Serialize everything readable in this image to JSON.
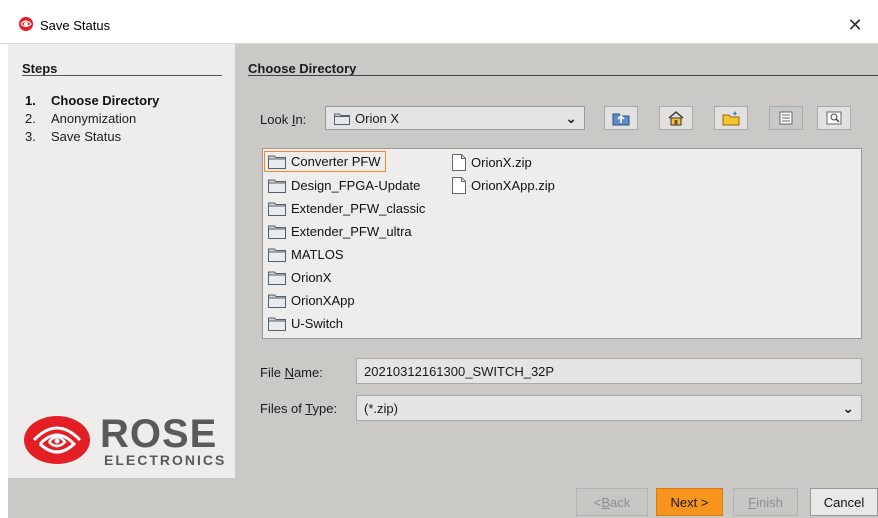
{
  "window": {
    "title": "Save Status",
    "close_label": "✕"
  },
  "steps": {
    "title": "Steps",
    "items": [
      {
        "num": "1.",
        "label": "Choose Directory"
      },
      {
        "num": "2.",
        "label": "Anonymization"
      },
      {
        "num": "3.",
        "label": "Save Status"
      }
    ]
  },
  "logo": {
    "word": "ROSE",
    "sub": "ELECTRONICS"
  },
  "main": {
    "title": "Choose Directory",
    "look_in": {
      "label_pre": "Look ",
      "label_u": "I",
      "label_post": "n:",
      "value": "Orion X"
    },
    "toolbar_icons": [
      "up-folder-icon",
      "home-icon",
      "new-folder-icon",
      "list-view-icon",
      "details-view-icon"
    ],
    "files": [
      {
        "name": "Converter PFW",
        "type": "folder"
      },
      {
        "name": "Design_FPGA-Update",
        "type": "folder"
      },
      {
        "name": "Extender_PFW_classic",
        "type": "folder"
      },
      {
        "name": "Extender_PFW_ultra",
        "type": "folder"
      },
      {
        "name": "MATLOS",
        "type": "folder"
      },
      {
        "name": "OrionX",
        "type": "folder"
      },
      {
        "name": "OrionXApp",
        "type": "folder"
      },
      {
        "name": "U-Switch",
        "type": "folder"
      },
      {
        "name": "OrionX.zip",
        "type": "file"
      },
      {
        "name": "OrionXApp.zip",
        "type": "file"
      }
    ],
    "file_name": {
      "label_pre": "File ",
      "label_u": "N",
      "label_post": "ame:",
      "value": "20210312161300_SWITCH_32P"
    },
    "file_type": {
      "label_pre": "Files of ",
      "label_u": "T",
      "label_post": "ype:",
      "value": "(*.zip)"
    }
  },
  "buttons": {
    "back": {
      "pre": "< ",
      "u": "B",
      "post": "ack"
    },
    "next": "Next >",
    "finish": {
      "u": "F",
      "post": "inish"
    },
    "cancel": "Cancel"
  },
  "colors": {
    "accent": "#f7941d",
    "selection_border": "#f08a2c",
    "logo_red": "#e31e24"
  }
}
